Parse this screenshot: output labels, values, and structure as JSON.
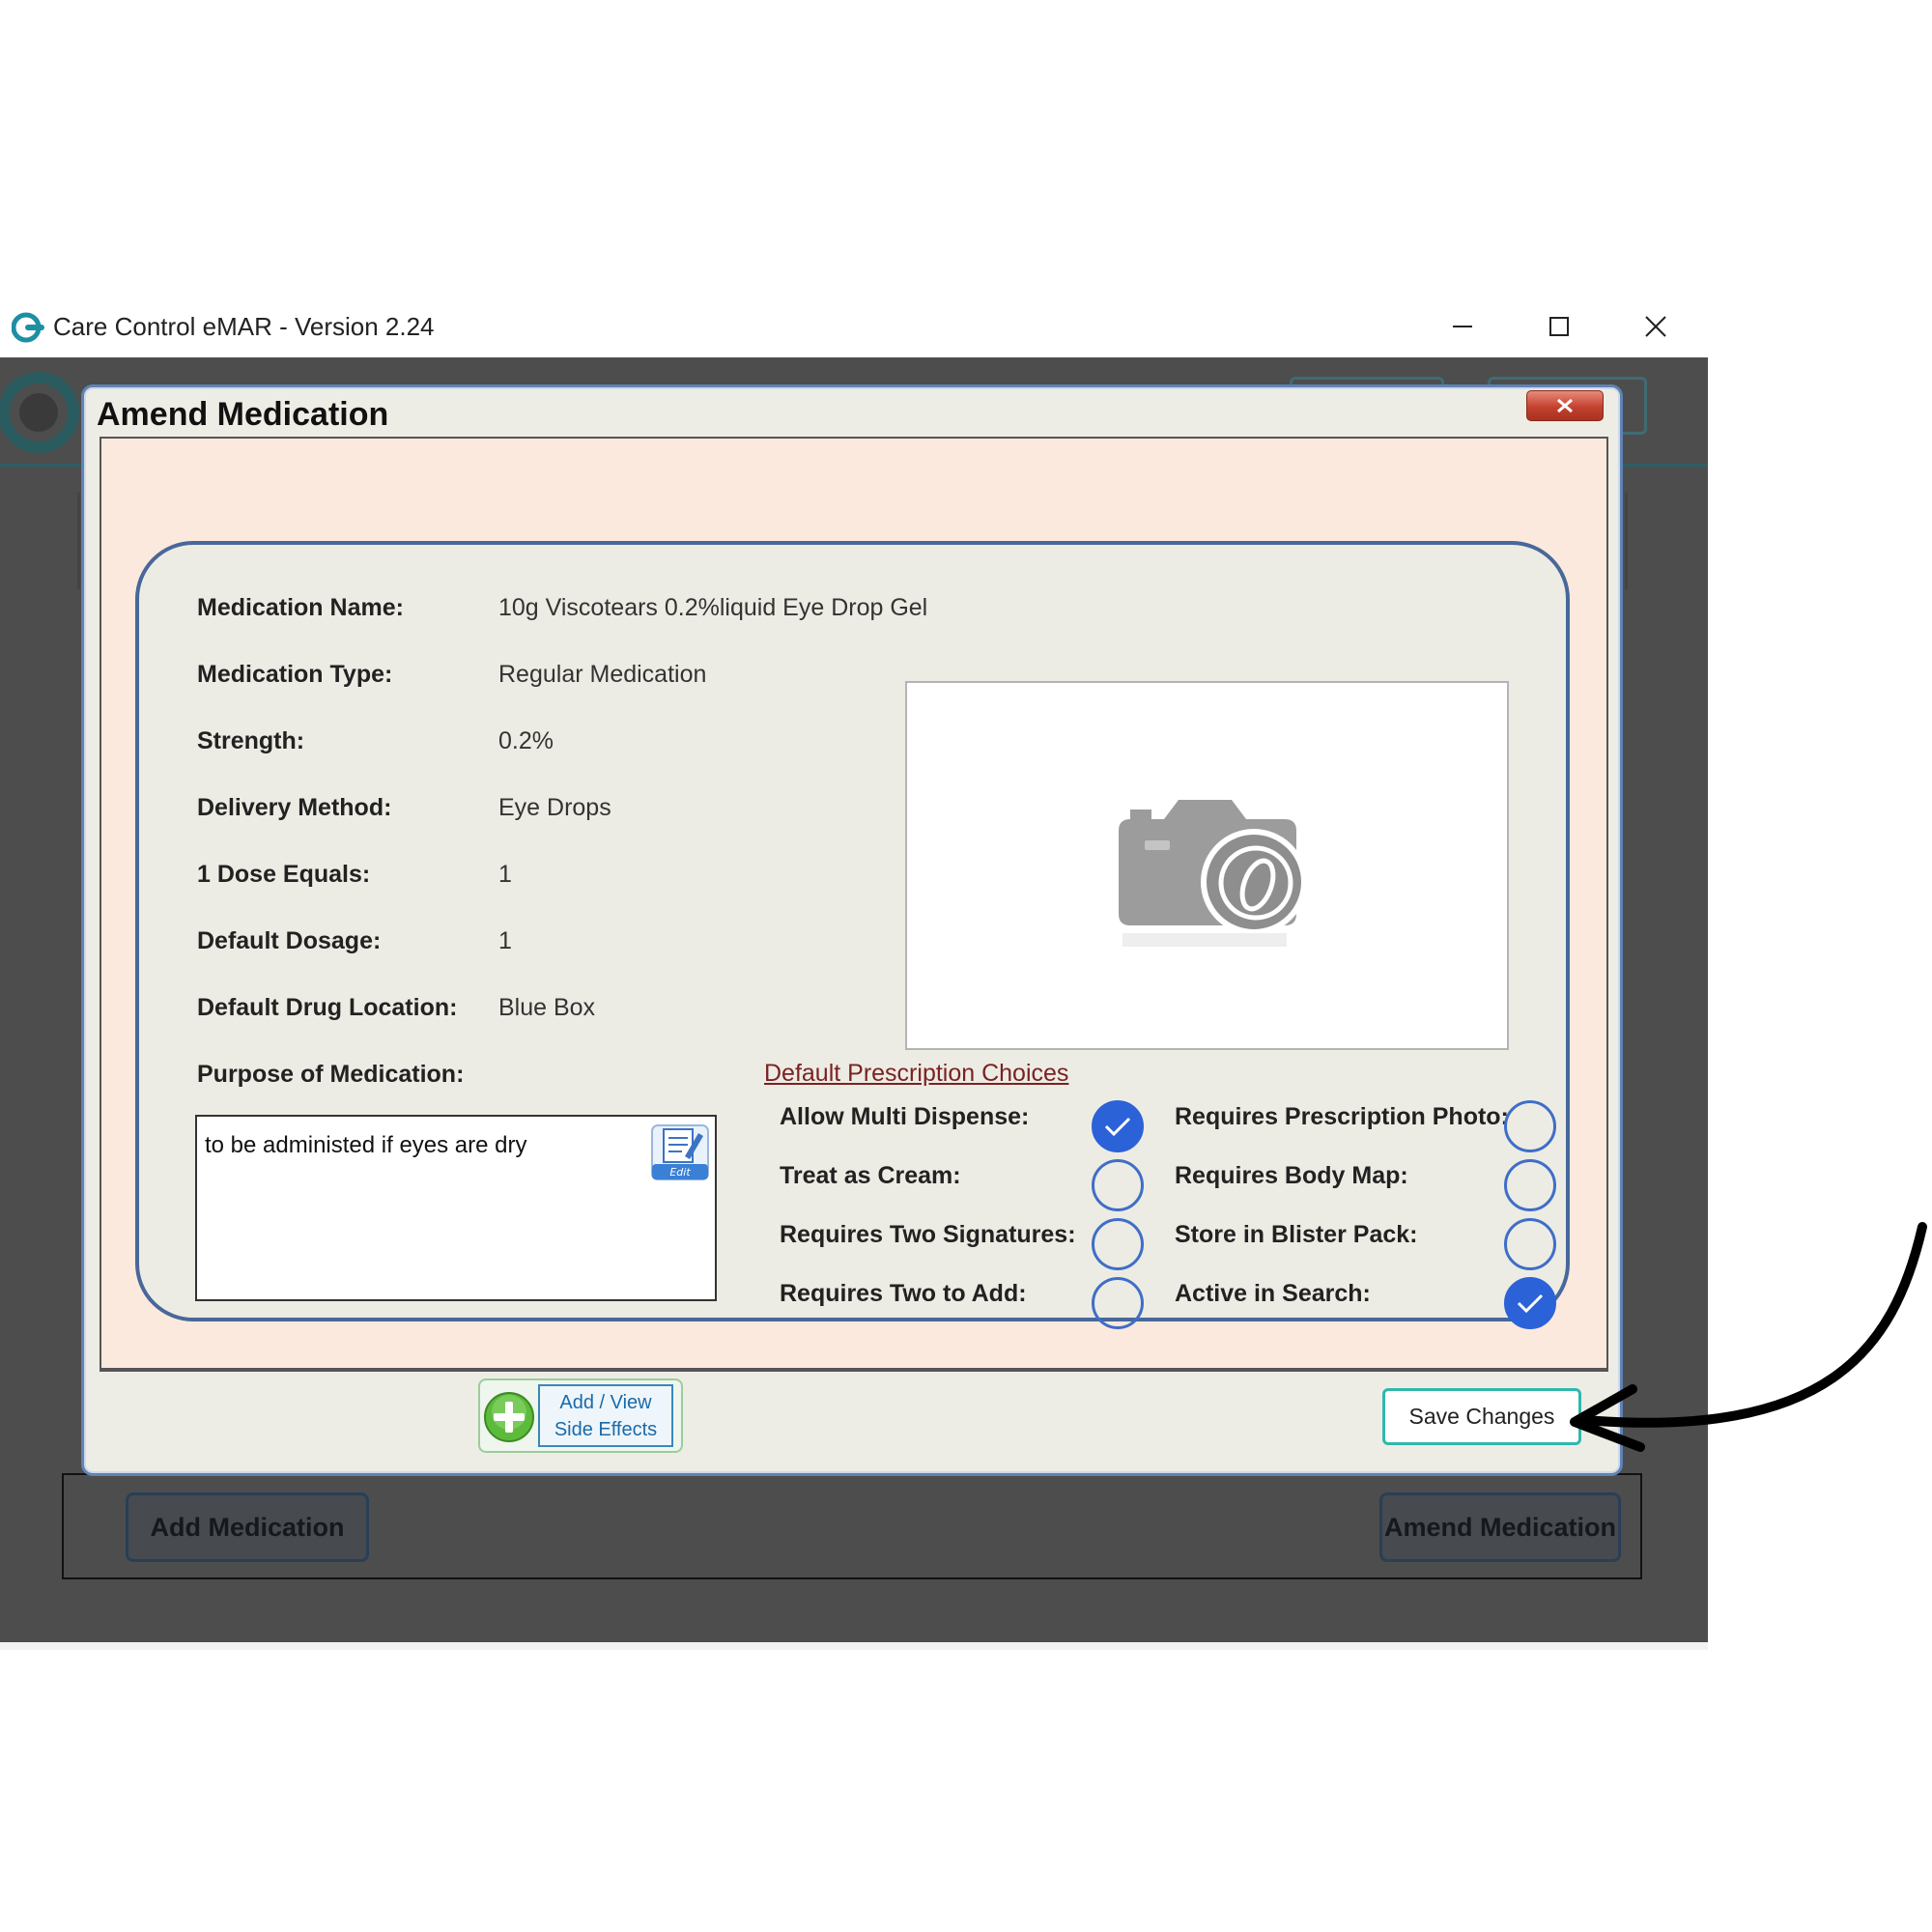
{
  "window": {
    "title": "Care Control eMAR - Version 2.24"
  },
  "background": {
    "add_medication_label": "Add Medication",
    "amend_medication_label": "Amend Medication"
  },
  "dialog": {
    "title": "Amend Medication",
    "close_label": "x",
    "fields": [
      {
        "label": "Medication Name:",
        "value": "10g Viscotears 0.2%liquid Eye Drop Gel"
      },
      {
        "label": "Medication Type:",
        "value": "Regular Medication"
      },
      {
        "label": "Strength:",
        "value": "0.2%"
      },
      {
        "label": "Delivery Method:",
        "value": "Eye Drops"
      },
      {
        "label": "1 Dose Equals:",
        "value": "1"
      },
      {
        "label": "Default Dosage:",
        "value": "1"
      },
      {
        "label": "Default Drug Location:",
        "value": "Blue Box"
      }
    ],
    "purpose_label": "Purpose of Medication:",
    "purpose_text": "to be administed if eyes are dry",
    "edit_icon_label": "Edit",
    "prescription_header": "Default Prescription Choices",
    "options": [
      {
        "label": "Allow Multi Dispense:",
        "checked": true
      },
      {
        "label": "Treat as Cream:",
        "checked": false
      },
      {
        "label": "Requires Two Signatures:",
        "checked": false
      },
      {
        "label": "Requires Two to Add:",
        "checked": false
      },
      {
        "label": "Requires Prescription Photo:",
        "checked": false
      },
      {
        "label": "Requires Body Map:",
        "checked": false
      },
      {
        "label": "Store in Blister Pack:",
        "checked": false
      },
      {
        "label": "Active in Search:",
        "checked": true
      }
    ],
    "side_effects_line1": "Add / View",
    "side_effects_line2": "Side Effects",
    "save_label": "Save Changes"
  },
  "colors": {
    "accent_blue": "#2b62d8",
    "dialog_border": "#5f83b4",
    "content_bg": "#fce9de",
    "save_border": "#2fb8ac"
  }
}
